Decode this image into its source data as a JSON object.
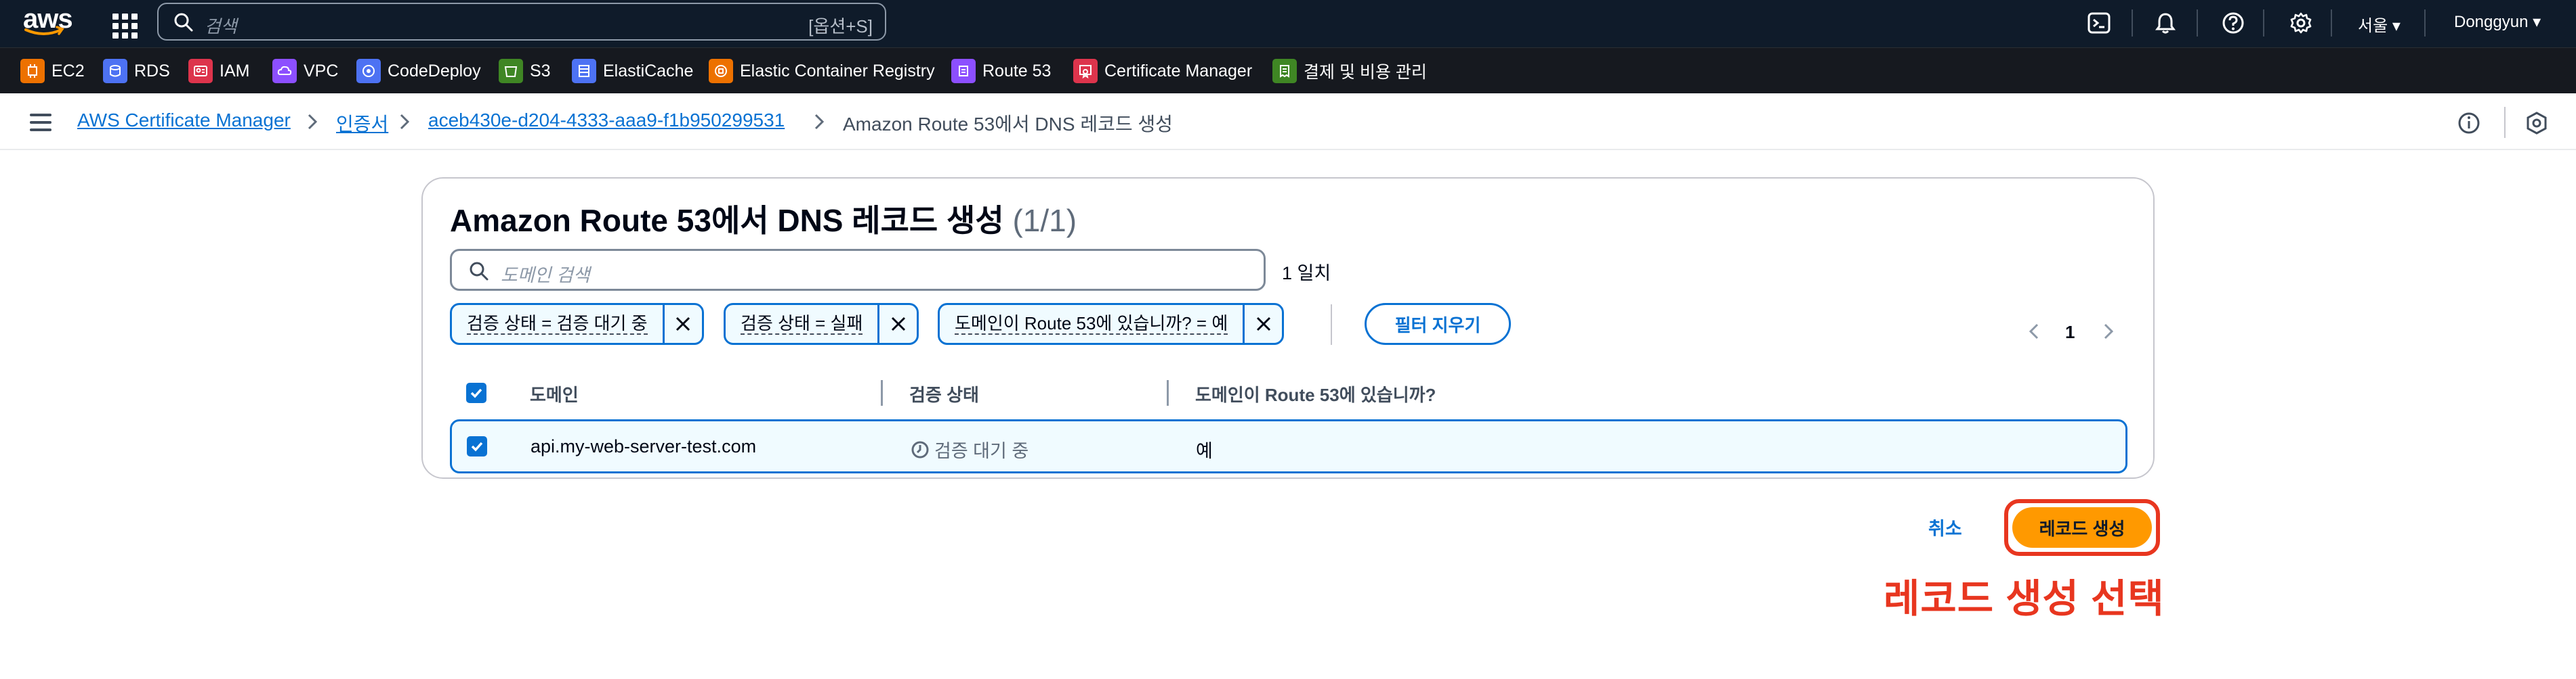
{
  "topnav": {
    "search_placeholder": "검색",
    "search_shortcut": "[옵션+S]",
    "region": "서울",
    "user": "Donggyun",
    "icons": [
      "aws-logo",
      "grid-icon",
      "cloudshell-icon",
      "bell-icon",
      "help-icon",
      "gear-icon"
    ]
  },
  "favorites": [
    {
      "label": "EC2",
      "color": "#ed7100"
    },
    {
      "label": "RDS",
      "color": "#4d72f3"
    },
    {
      "label": "IAM",
      "color": "#dd344c"
    },
    {
      "label": "VPC",
      "color": "#8c4fff"
    },
    {
      "label": "CodeDeploy",
      "color": "#4d72f3"
    },
    {
      "label": "S3",
      "color": "#3f8624"
    },
    {
      "label": "ElastiCache",
      "color": "#4d72f3"
    },
    {
      "label": "Elastic Container Registry",
      "color": "#ed7100"
    },
    {
      "label": "Route 53",
      "color": "#8c4fff"
    },
    {
      "label": "Certificate Manager",
      "color": "#dd344c"
    },
    {
      "label": "결제 및 비용 관리",
      "color": "#3f8624"
    }
  ],
  "breadcrumb": {
    "items": [
      "AWS Certificate Manager",
      "인증서",
      "aceb430e-d204-4333-aaa9-f1b950299531"
    ],
    "current": "Amazon Route 53에서 DNS 레코드 생성"
  },
  "panel": {
    "title": "Amazon Route 53에서 DNS 레코드 생성",
    "count": "(1/1)",
    "search_placeholder": "도메인 검색",
    "match_text": "1 일치",
    "filters": [
      "검증 상태 = 검증 대기 중",
      "검증 상태 = 실패",
      "도메인이 Route 53에 있습니까? = 예"
    ],
    "clear_filters": "필터 지우기",
    "page": "1",
    "columns": [
      "도메인",
      "검증 상태",
      "도메인이 Route 53에 있습니까?"
    ],
    "rows": [
      {
        "domain": "api.my-web-server-test.com",
        "status": "검증 대기 중",
        "in_route53": "예",
        "selected": true
      }
    ]
  },
  "actions": {
    "cancel": "취소",
    "create": "레코드 생성"
  },
  "annotation": "레코드 생성 선택",
  "colors": {
    "accent": "#0972d3",
    "primary_button": "#ff9900",
    "annotation": "#e8361f",
    "nav_bg": "#0f1b2a"
  }
}
